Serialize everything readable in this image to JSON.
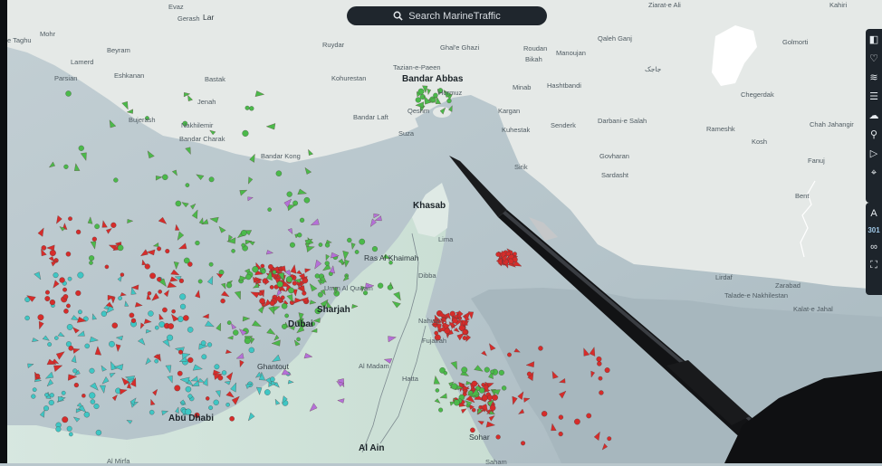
{
  "search": {
    "placeholder": "Search MarineTraffic"
  },
  "toolbar": {
    "icons": [
      "layers-icon",
      "favorite-icon",
      "stack-icon",
      "filter-icon",
      "weather-icon",
      "route-icon",
      "play-icon",
      "measure-icon"
    ],
    "count_label": "301",
    "count_prefix": "A"
  },
  "places": {
    "evaz": "Evaz",
    "gerash": "Gerash",
    "lar": "Lar",
    "taghu": "e Taghu",
    "mohr": "Mohr",
    "beyram": "Beyram",
    "lamerd": "Lamerd",
    "parsian": "Parsian",
    "eshkanan": "Eshkanan",
    "bastak": "Bastak",
    "jenah": "Jenah",
    "bujerash": "Bujerash",
    "nakhilemir": "Nakhilemir",
    "bandar_charak": "Bandar Charak",
    "ruydar": "Ruydar",
    "ghale_ghazi": "Ghal'e Ghazi",
    "roudan": "Roudan",
    "bikah": "Bikah",
    "manoujan": "Manoujan",
    "qaleh_ganj": "Qaleh Ganj",
    "golmorti": "Golmorti",
    "tazian": "Tazian-e-Paeen",
    "kohurestan": "Kohurestan",
    "bandar_abbas": "Bandar Abbas",
    "hormuz": "Hormuz",
    "qeshm": "Qeshm",
    "bandar_laft": "Bandar Laft",
    "suza": "Suza",
    "minab": "Minab",
    "hashtbandi": "Hashtbandi",
    "jask_persian": "جاجک",
    "chegerdak": "Chegerdak",
    "kargan": "Kargan",
    "kuhestak": "Kuhestak",
    "senderk": "Senderk",
    "darbani": "Darbani-e Salah",
    "rameshk": "Rameshk",
    "chah_jahangir": "Chah Jahangir",
    "kosh": "Kosh",
    "bandar_kong": "Bandar Kong",
    "sirik": "Sirik",
    "govharan": "Govharan",
    "sardasht": "Sardasht",
    "fanuj": "Fanuj",
    "bent": "Bent",
    "khasab": "Khasab",
    "lima": "Lima",
    "ras_al_khaimah": "Ras Al Khaimah",
    "dibba": "Dibba",
    "umm_al_quwain": "Umm Al Quwain",
    "sharjah": "Sharjah",
    "dubai": "Dubai",
    "nahwa": "Nahwa",
    "fujairah": "Fujairah",
    "al_madam": "Al Madam",
    "hatta": "Hatta",
    "ghantout": "Ghantout",
    "abu_dhabi": "Abu Dhabi",
    "al_ain": "Al Ain",
    "sohar": "Sohar",
    "saham": "Saham",
    "al_mirfa": "Al Mirfa",
    "lirdaf": "Lirdaf",
    "zarabad": "Zarabad",
    "talade": "Talade-e Nakhilestan",
    "kalat": "Kalat-e Jahal",
    "ziarat": "Ziarat-e Ali",
    "kahiri": "Kahiri"
  },
  "colors": {
    "sea": "#b8c8cf",
    "land": "#e7ece9",
    "land_green": "#cfe2d8",
    "vessel_red": "#d62c2a",
    "vessel_green": "#4bb94a",
    "vessel_cyan": "#3fc6c4",
    "vessel_purple": "#b470d8",
    "toolbar_bg": "#1d242b"
  }
}
